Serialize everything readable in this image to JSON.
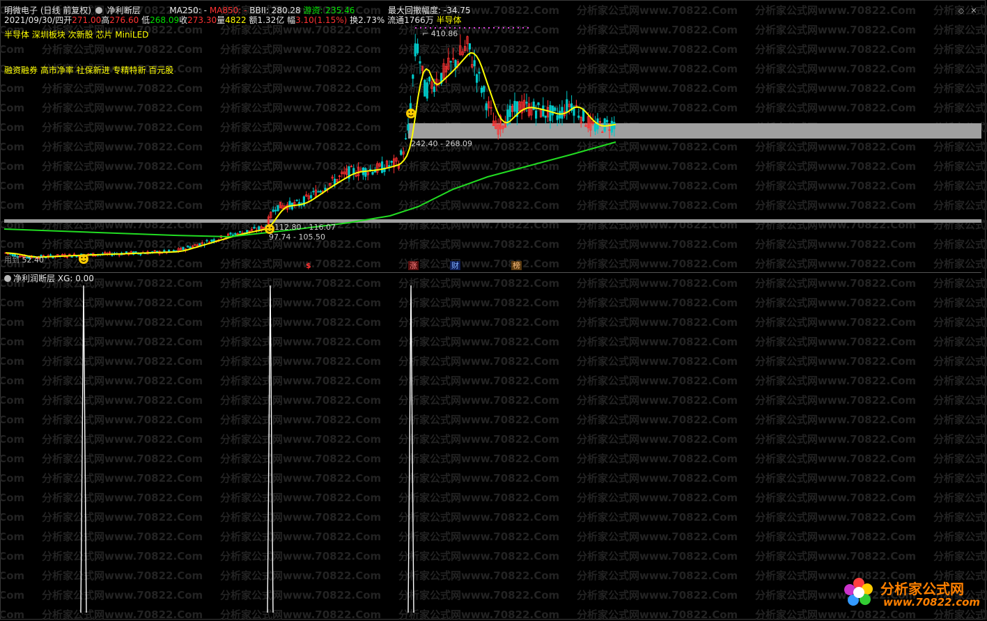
{
  "header": {
    "stock_title": "明微电子 (日线 前复权)",
    "indicator_title": "净利断层",
    "ma250_label": "MA250: -",
    "ma850_label": "MA850: -",
    "bbii_label": "BBII: 280.28",
    "youzi_label": "游资: 235.46",
    "drawdown_label": "最大回撤幅度: -34.75"
  },
  "quote": {
    "date": "2021/09/30/四",
    "open_label": "开",
    "open": "271.00",
    "high_label": "高",
    "high": "276.60",
    "low_label": "低",
    "low": "268.09",
    "close_label": "收",
    "close": "273.30",
    "volume_label": "量",
    "volume": "4822",
    "amount": "额1.32亿",
    "amp_label": "幅",
    "amp": "3.10(1.15%)",
    "turnover": "换2.73%",
    "float": "流通1766万",
    "sector": "半导体"
  },
  "tags": {
    "line1": "半导体 深圳板块 次新股 芯片 MiniLED",
    "line2": "融资融券 高市净率 社保新进 专精特新 百元股"
  },
  "price_labels": {
    "peak": "410.86",
    "zone_high": "242.40 - 268.09",
    "zone_mid": "112.80 - 116.07",
    "zone_low": "97.74 - 105.50",
    "bottom": "52.40",
    "bottom_prefix": "用到"
  },
  "event_markers": [
    {
      "text": "$",
      "color": "#ff3030"
    },
    {
      "text": "涨",
      "color": "#ff6060"
    },
    {
      "text": "财",
      "color": "#60a0ff"
    },
    {
      "text": "榜",
      "color": "#ffb060"
    }
  ],
  "sub_panel": {
    "title": "净利润断层",
    "value": "XG: 0.00"
  },
  "watermark": {
    "text": "分析家公式网www.70822.Com"
  },
  "logo": {
    "name": "分析家公式网",
    "url": "www.70822.com"
  },
  "colors": {
    "ma_yellow": "#ffff00",
    "ma_green": "#22dd22",
    "up": "#ff3232",
    "down": "#00c8c8",
    "zone": "#a0a0a0"
  },
  "chart_data": {
    "type": "candlestick",
    "note_series": [
      "MA (yellow)",
      "long MA (green)"
    ],
    "key_levels": [
      410.86,
      268.09,
      242.4,
      116.07,
      112.8,
      105.5,
      97.74,
      52.4
    ],
    "last_bar": {
      "date": "2021/09/30",
      "open": 271.0,
      "high": 276.6,
      "low": 268.09,
      "close": 273.3
    },
    "sub_indicator_spikes": 3
  }
}
